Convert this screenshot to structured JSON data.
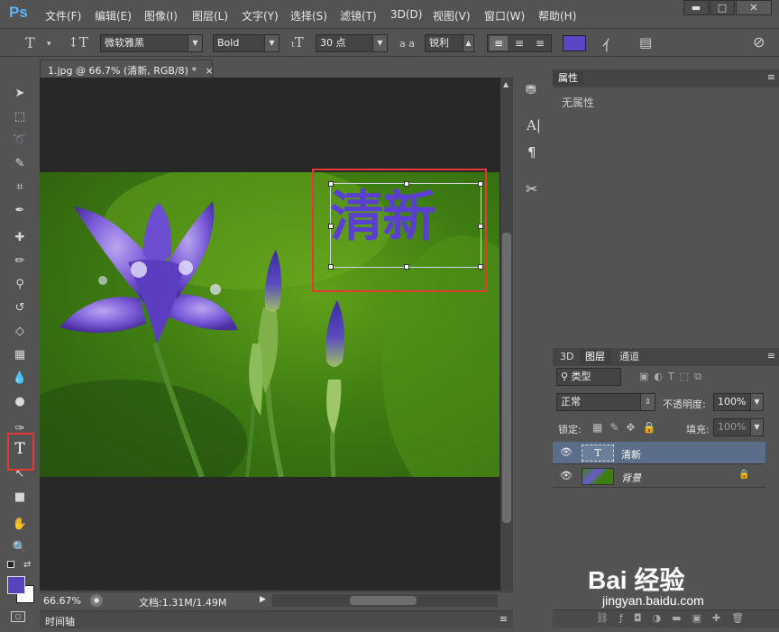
{
  "app": {
    "logo": "Ps"
  },
  "menu": [
    "文件(F)",
    "编辑(E)",
    "图像(I)",
    "图层(L)",
    "文字(Y)",
    "选择(S)",
    "滤镜(T)",
    "3D(D)",
    "视图(V)",
    "窗口(W)",
    "帮助(H)"
  ],
  "window_controls": {
    "minimize": "▬",
    "maximize": "□",
    "close": "✕"
  },
  "options_bar": {
    "font_family": "微软雅黑",
    "font_style": "Bold",
    "font_size": "30 点",
    "antialias_label": "a a",
    "antialias": "锐利",
    "text_color": "#5b46c8"
  },
  "document": {
    "tab_title": "1.jpg @ 66.7% (清新, RGB/8) *",
    "close": "×",
    "text_layer_content": "清新",
    "zoom": "66.67%",
    "doc_info": "文档:1.31M/1.49M"
  },
  "timeline_label": "时间轴",
  "properties_panel": {
    "tab": "属性",
    "content": "无属性"
  },
  "layers_panel": {
    "tabs": [
      "3D",
      "图层",
      "通道"
    ],
    "active_tab": "图层",
    "filter_label": "类型",
    "blend_mode": "正常",
    "opacity_label": "不透明度:",
    "opacity": "100%",
    "lock_label": "锁定:",
    "fill_label": "填充:",
    "fill": "100%",
    "layers": [
      {
        "name": "清新",
        "type": "text",
        "thumb": "T"
      },
      {
        "name": "背景",
        "type": "image",
        "locked": true
      }
    ]
  },
  "colors": {
    "foreground": "#5544bb",
    "background": "#ffffff",
    "accent": "#5cb4ff"
  },
  "watermark": {
    "logo": "Bai 经验",
    "url": "jingyan.baidu.com"
  }
}
